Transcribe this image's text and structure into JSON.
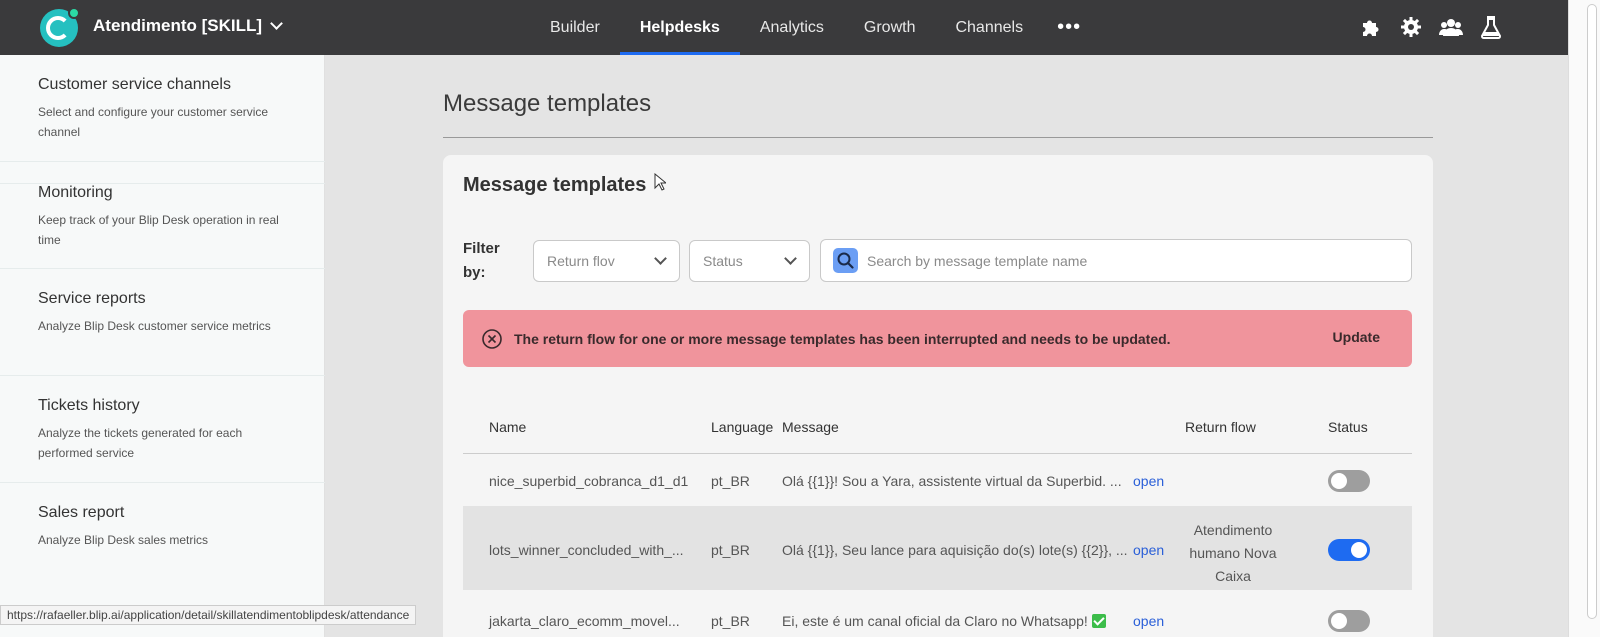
{
  "topbar": {
    "app_name": "Atendimento [SKILL]",
    "nav": [
      "Builder",
      "Helpdesks",
      "Analytics",
      "Growth",
      "Channels"
    ],
    "active_nav": "Helpdesks",
    "more": "•••",
    "icons": [
      "puzzle-icon",
      "gear-icon",
      "team-icon",
      "flask-icon"
    ]
  },
  "sidebar": {
    "items": [
      {
        "title": "Customer service channels",
        "desc": "Select and configure your customer service channel"
      },
      {
        "title": "Monitoring",
        "desc": "Keep track of your Blip Desk operation in real time"
      },
      {
        "title": "Service reports",
        "desc": "Analyze Blip Desk customer service metrics"
      },
      {
        "title": "Tickets history",
        "desc": "Analyze the tickets generated for each performed service"
      },
      {
        "title": "Sales report",
        "desc": "Analyze Blip Desk sales metrics"
      }
    ]
  },
  "main": {
    "page_title": "Message templates",
    "card_title": "Message templates",
    "filter_label": "Filter by:",
    "return_flow_select": "Return flov",
    "status_select": "Status",
    "search_placeholder": "Search by message template name",
    "alert": {
      "text": "The return flow for one or more message templates has been interrupted and needs to be updated.",
      "button": "Update",
      "color": "#f0949c"
    },
    "table": {
      "headers": [
        "Name",
        "Language",
        "Message",
        "Return flow",
        "Status"
      ],
      "rows": [
        {
          "name": "nice_superbid_cobranca_d1_d1",
          "language": "pt_BR",
          "message": "Olá {{1}}! Sou a Yara, assistente virtual da Superbid. ...",
          "link": "open",
          "return_flow": "",
          "status": "off"
        },
        {
          "name": "lots_winner_concluded_with_...",
          "language": "pt_BR",
          "message": "Olá {{1}}, Seu lance para aquisição do(s) lote(s) {{2}}, ...",
          "link": "open",
          "return_flow": "Atendimento humano Nova Caixa",
          "status": "on"
        },
        {
          "name": "jakarta_claro_ecomm_movel...",
          "language": "pt_BR",
          "message": "Ei, este é um canal oficial da Claro no Whatsapp!",
          "link": "open",
          "return_flow": "",
          "status": "off"
        }
      ]
    }
  },
  "statusbar": {
    "url": "https://rafaeller.blip.ai/application/detail/skillatendimentoblipdesk/attendance"
  },
  "colors": {
    "accent": "#1e6bf1",
    "topbar": "#3a3a3c",
    "brand": "#25c0c0"
  }
}
